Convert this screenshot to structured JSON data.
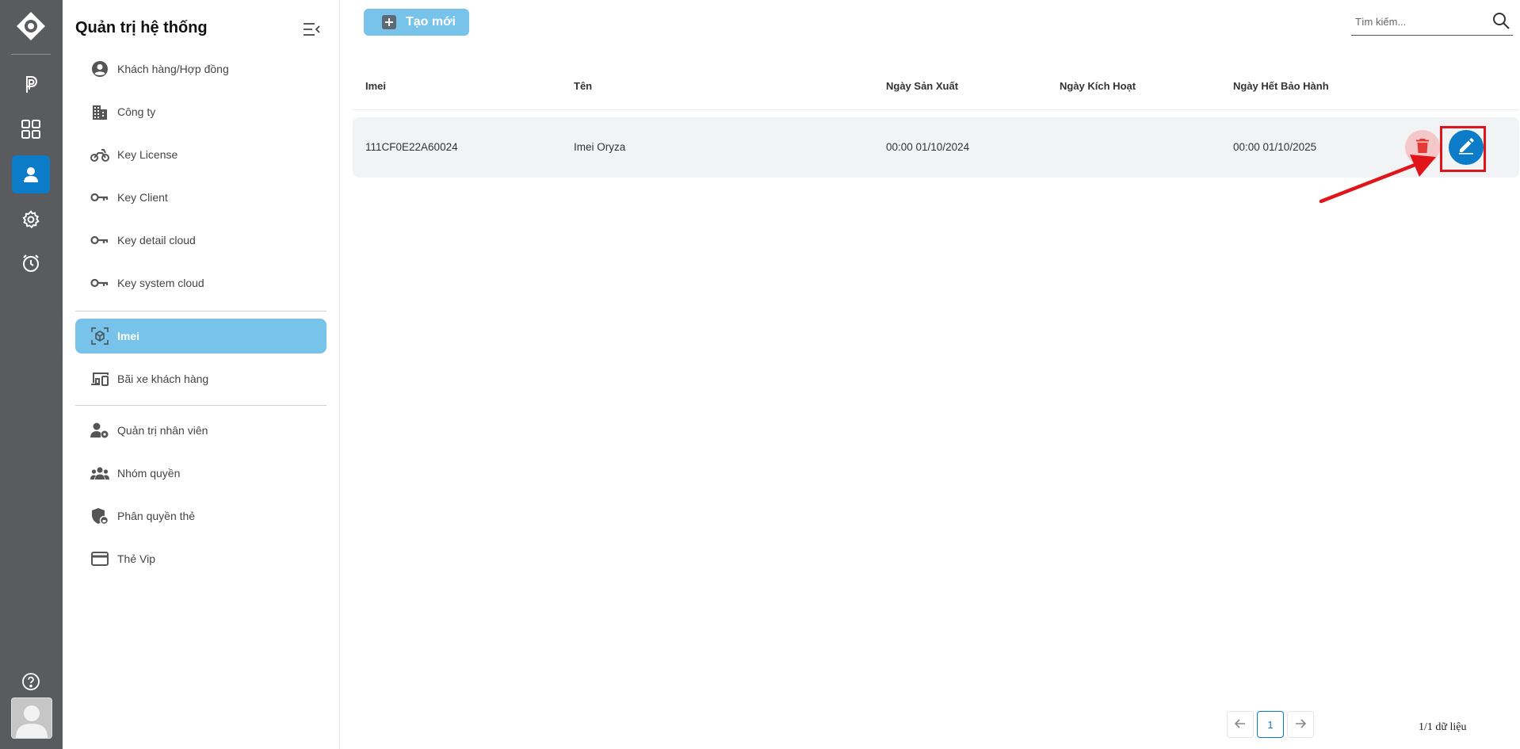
{
  "sidebar": {
    "title": "Quản trị hệ thống",
    "items": [
      {
        "label": "Khách hàng/Hợp đồng",
        "icon": "user-circle-icon"
      },
      {
        "label": "Công ty",
        "icon": "building-icon"
      },
      {
        "label": "Key License",
        "icon": "motorbike-icon"
      },
      {
        "label": "Key Client",
        "icon": "key-icon"
      },
      {
        "label": "Key detail cloud",
        "icon": "key-icon"
      },
      {
        "label": "Key system cloud",
        "icon": "key-icon"
      },
      {
        "label": "Imei",
        "icon": "cube-scan-icon",
        "active": true
      },
      {
        "label": "Bãi xe khách hàng",
        "icon": "devices-icon"
      },
      {
        "label": "Quản trị nhân viên",
        "icon": "user-settings-icon"
      },
      {
        "label": "Nhóm quyền",
        "icon": "group-icon"
      },
      {
        "label": "Phân quyền thẻ",
        "icon": "shield-lock-icon"
      },
      {
        "label": "Thẻ Vip",
        "icon": "credit-card-icon"
      }
    ]
  },
  "toolbar": {
    "create_label": "Tạo mới",
    "search_placeholder": "Tìm kiếm..."
  },
  "table": {
    "headers": [
      "Imei",
      "Tên",
      "Ngày Sản Xuất",
      "Ngày Kích Hoạt",
      "Ngày Hết Bảo Hành"
    ],
    "rows": [
      {
        "imei": "111CF0E22A60024",
        "name": "Imei Oryza",
        "manufactured": "00:00 01/10/2024",
        "activated": "",
        "warranty_end": "00:00 01/10/2025"
      }
    ]
  },
  "pagination": {
    "current_page": "1",
    "summary": "1/1 dữ liệu"
  },
  "colors": {
    "primary": "#0c7cc9",
    "active_menu": "#78c3ea",
    "rail": "#595b5e",
    "danger": "#e53935",
    "highlight": "#e1141a"
  }
}
